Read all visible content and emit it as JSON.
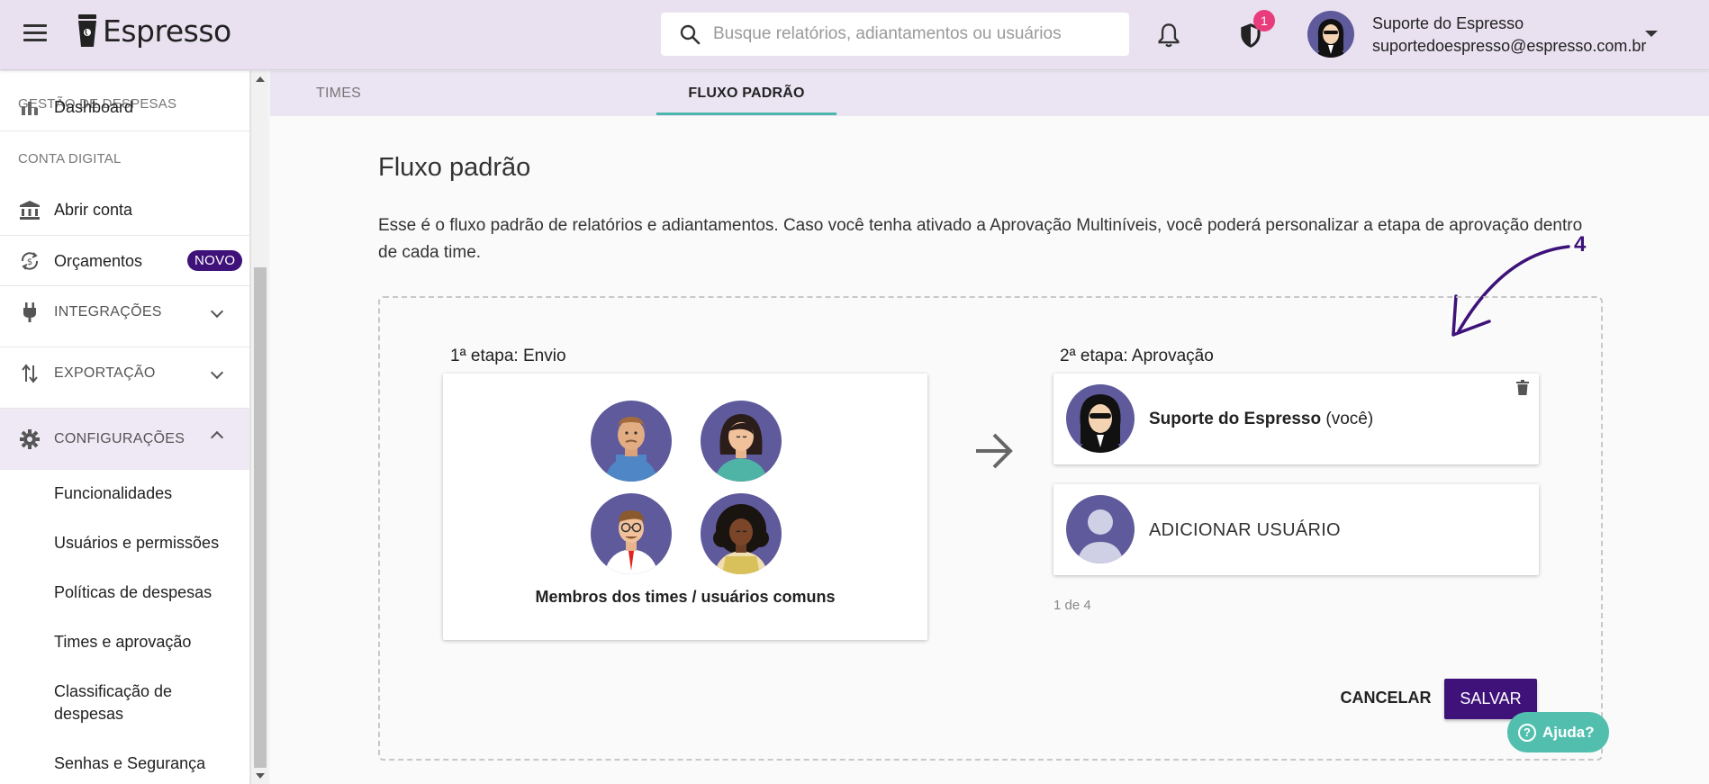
{
  "app": {
    "brand": "Espresso"
  },
  "header": {
    "search_placeholder": "Busque relatórios, adiantamentos ou usuários",
    "notification_badge": "1",
    "user_name": "Suporte do Espresso",
    "user_email": "suportedoespresso@espresso.com.br"
  },
  "sidebar": {
    "section_gestao": "GESTÃO DE DESPESAS",
    "dashboard": "Dashboard",
    "section_conta": "CONTA DIGITAL",
    "abrir_conta": "Abrir conta",
    "orcamentos": "Orçamentos",
    "novo_badge": "NOVO",
    "integracoes": "INTEGRAÇÕES",
    "exportacao": "EXPORTAÇÃO",
    "configuracoes": "CONFIGURAÇÕES",
    "sub_items": [
      "Funcionalidades",
      "Usuários e permissões",
      "Políticas de despesas",
      "Times e aprovação",
      "Classificação de despesas",
      "Senhas e Segurança"
    ]
  },
  "tabs": [
    "TIMES",
    "FLUXO PADRÃO"
  ],
  "active_tab": "FLUXO PADRÃO",
  "main": {
    "title": "Fluxo padrão",
    "description": "Esse é o fluxo padrão de relatórios e adiantamentos. Caso você tenha ativado a Aprovação Multiníveis, você poderá personalizar a etapa de aprovação dentro de cada time.",
    "step1_label": "1ª etapa: Envio",
    "step1_members": "Membros dos times / usuários comuns",
    "step2_label": "2ª etapa: Aprovação",
    "approver_name": "Suporte do Espresso",
    "approver_suffix": "(você)",
    "add_user": "ADICIONAR USUÁRIO",
    "pagination": "1 de 4",
    "cancel": "CANCELAR",
    "save": "SALVAR",
    "annotation_number": "4"
  },
  "help": {
    "label": "Ajuda?"
  },
  "colors": {
    "header_bg": "#e9e1f0",
    "primary": "#3f127a",
    "accent_teal": "#4db6ac",
    "badge_pink": "#e83c7d",
    "avatar_bg": "#5e5a9b",
    "help_bg": "#52bfae"
  }
}
